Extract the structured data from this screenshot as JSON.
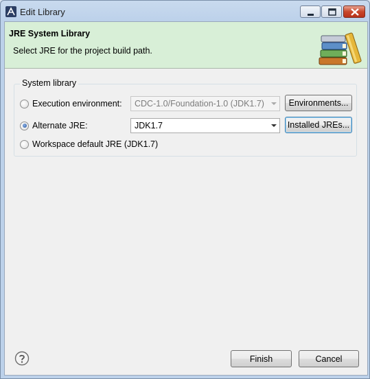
{
  "window": {
    "title": "Edit Library"
  },
  "banner": {
    "title": "JRE System Library",
    "message": "Select JRE for the project build path."
  },
  "group": {
    "legend": "System library",
    "execution_env": {
      "label": "Execution environment:",
      "value": "CDC-1.0/Foundation-1.0 (JDK1.7)",
      "selected": false,
      "button": "Environments..."
    },
    "alternate_jre": {
      "label": "Alternate JRE:",
      "value": "JDK1.7",
      "selected": true,
      "button": "Installed JREs..."
    },
    "workspace_default": {
      "label": "Workspace default JRE (JDK1.7)",
      "selected": false
    }
  },
  "footer": {
    "finish": "Finish",
    "cancel": "Cancel"
  },
  "colors": {
    "banner_bg": "#d8efd7",
    "dialog_bg": "#f0f0f0",
    "close_button": "#c8472b"
  },
  "icons": [
    "eclipse-app-icon",
    "minimize-icon",
    "maximize-icon",
    "close-icon",
    "library-books-icon",
    "help-icon"
  ]
}
